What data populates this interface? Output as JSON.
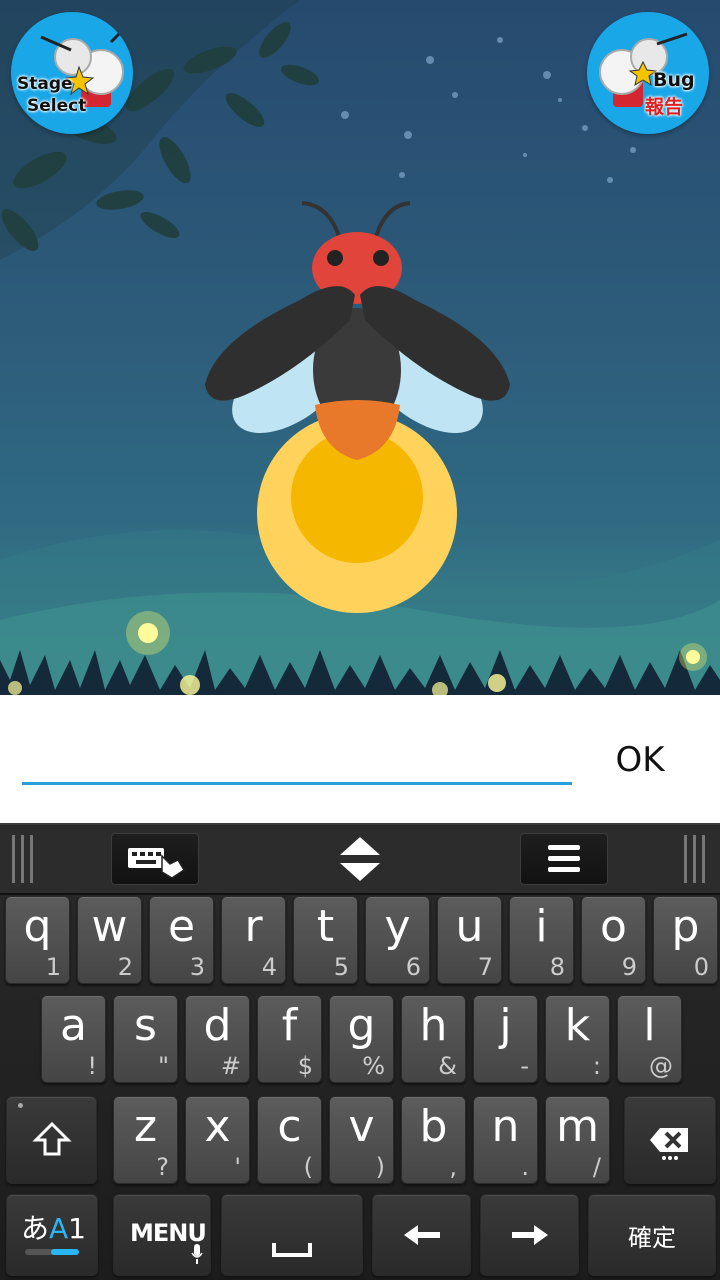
{
  "scene": {
    "stage_select": {
      "line1": "Stage",
      "line2": "Select",
      "icon": "firefly-mascot-icon"
    },
    "bug_report": {
      "line1": "Bug",
      "line2": "報告",
      "icon": "firefly-mascot-icon"
    },
    "character": "firefly",
    "colors": {
      "sky": "#264a6e",
      "button": "#1aa7e8",
      "glow": "#f5b700",
      "head": "#e0443a"
    }
  },
  "input": {
    "value": "",
    "placeholder": "",
    "ok_label": "OK"
  },
  "keyboard": {
    "toolbar": [
      "keyboard-switch-icon",
      "resize-arrows-icon",
      "menu-lines-icon"
    ],
    "row1": [
      {
        "k": "q",
        "s": "1"
      },
      {
        "k": "w",
        "s": "2"
      },
      {
        "k": "e",
        "s": "3"
      },
      {
        "k": "r",
        "s": "4"
      },
      {
        "k": "t",
        "s": "5"
      },
      {
        "k": "y",
        "s": "6"
      },
      {
        "k": "u",
        "s": "7"
      },
      {
        "k": "i",
        "s": "8"
      },
      {
        "k": "o",
        "s": "9"
      },
      {
        "k": "p",
        "s": "0"
      }
    ],
    "row2": [
      {
        "k": "a",
        "s": "!"
      },
      {
        "k": "s",
        "s": "\""
      },
      {
        "k": "d",
        "s": "#"
      },
      {
        "k": "f",
        "s": "$"
      },
      {
        "k": "g",
        "s": "%"
      },
      {
        "k": "h",
        "s": "&"
      },
      {
        "k": "j",
        "s": "-"
      },
      {
        "k": "k",
        "s": ":"
      },
      {
        "k": "l",
        "s": "@"
      }
    ],
    "row3": [
      {
        "k": "z",
        "s": "?"
      },
      {
        "k": "x",
        "s": "'"
      },
      {
        "k": "c",
        "s": "("
      },
      {
        "k": "v",
        "s": ")"
      },
      {
        "k": "b",
        "s": ","
      },
      {
        "k": "n",
        "s": "."
      },
      {
        "k": "m",
        "s": "/"
      }
    ],
    "mode_label_a": "あ",
    "mode_label_b": "A",
    "mode_label_c": "1",
    "menu_label": "MENU",
    "confirm_label": "確定"
  }
}
